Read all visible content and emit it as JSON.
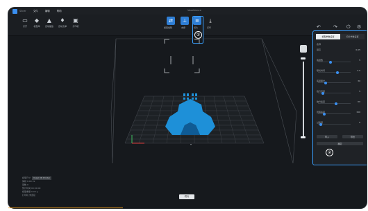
{
  "titlebar": {
    "app_name": "Slicer",
    "menus": [
      "文件",
      "编辑",
      "帮助"
    ],
    "center_title": "Voxeldance"
  },
  "toolbar": {
    "items": [
      {
        "label": "打开",
        "icon": "folder-icon"
      },
      {
        "label": "模型库",
        "icon": "model-library-icon"
      },
      {
        "label": "自动摆放",
        "icon": "auto-arrange-icon"
      },
      {
        "label": "自动支撑",
        "icon": "auto-support-icon"
      },
      {
        "label": "打印机",
        "icon": "printer-icon"
      }
    ],
    "modes": [
      {
        "label": "模型编辑",
        "icon": "edit-model-icon",
        "active": true
      },
      {
        "label": "支撑",
        "icon": "support-icon",
        "active": true
      },
      {
        "label": "切片",
        "icon": "slice-icon",
        "active": true
      },
      {
        "label": "打印",
        "icon": "print-icon",
        "active": false
      }
    ],
    "right_icons": [
      "undo-icon",
      "redo-icon",
      "power-icon",
      "settings-icon"
    ]
  },
  "annotations": {
    "marker_1": "①",
    "marker_2": "②"
  },
  "panel": {
    "tabs": [
      {
        "label": "模型参数设置",
        "active": true
      },
      {
        "label": "切片参数设置",
        "active": false
      }
    ],
    "rows": [
      {
        "label": "名称",
        "value": ""
      },
      {
        "label": "层高",
        "value": "0.05"
      },
      {
        "label": "底层数",
        "value": "5",
        "slider": 0.35
      },
      {
        "label": "曝光时间",
        "value": "2.5",
        "slider": 0.55
      },
      {
        "label": "底层曝光",
        "value": "30",
        "slider": 0.2
      },
      {
        "label": "抬升高度",
        "value": "5",
        "slider": 0.1
      },
      {
        "label": "抬升速度",
        "value": "60",
        "slider": 0.5
      },
      {
        "label": "回落速度",
        "value": "150",
        "slider": 0.15
      },
      {
        "label": "过渡层",
        "value": "0",
        "slider": 0.05
      }
    ],
    "buttons": {
      "left": "导入",
      "right": "导出",
      "bottom": "确定"
    }
  },
  "info": {
    "lines": [
      "模型尺寸",
      "体积 0.00 ml",
      "层数 0",
      "预计时间 00:00:00",
      "模型重量 0.00 g",
      "打印机 未连接"
    ],
    "highlight": "Voxel 3D Printer"
  },
  "bottom_button": "切片",
  "colors": {
    "accent": "#3a8ff0",
    "model": "#1e90d8",
    "grid": "#3e4248",
    "marker": "#3aa0ff"
  }
}
